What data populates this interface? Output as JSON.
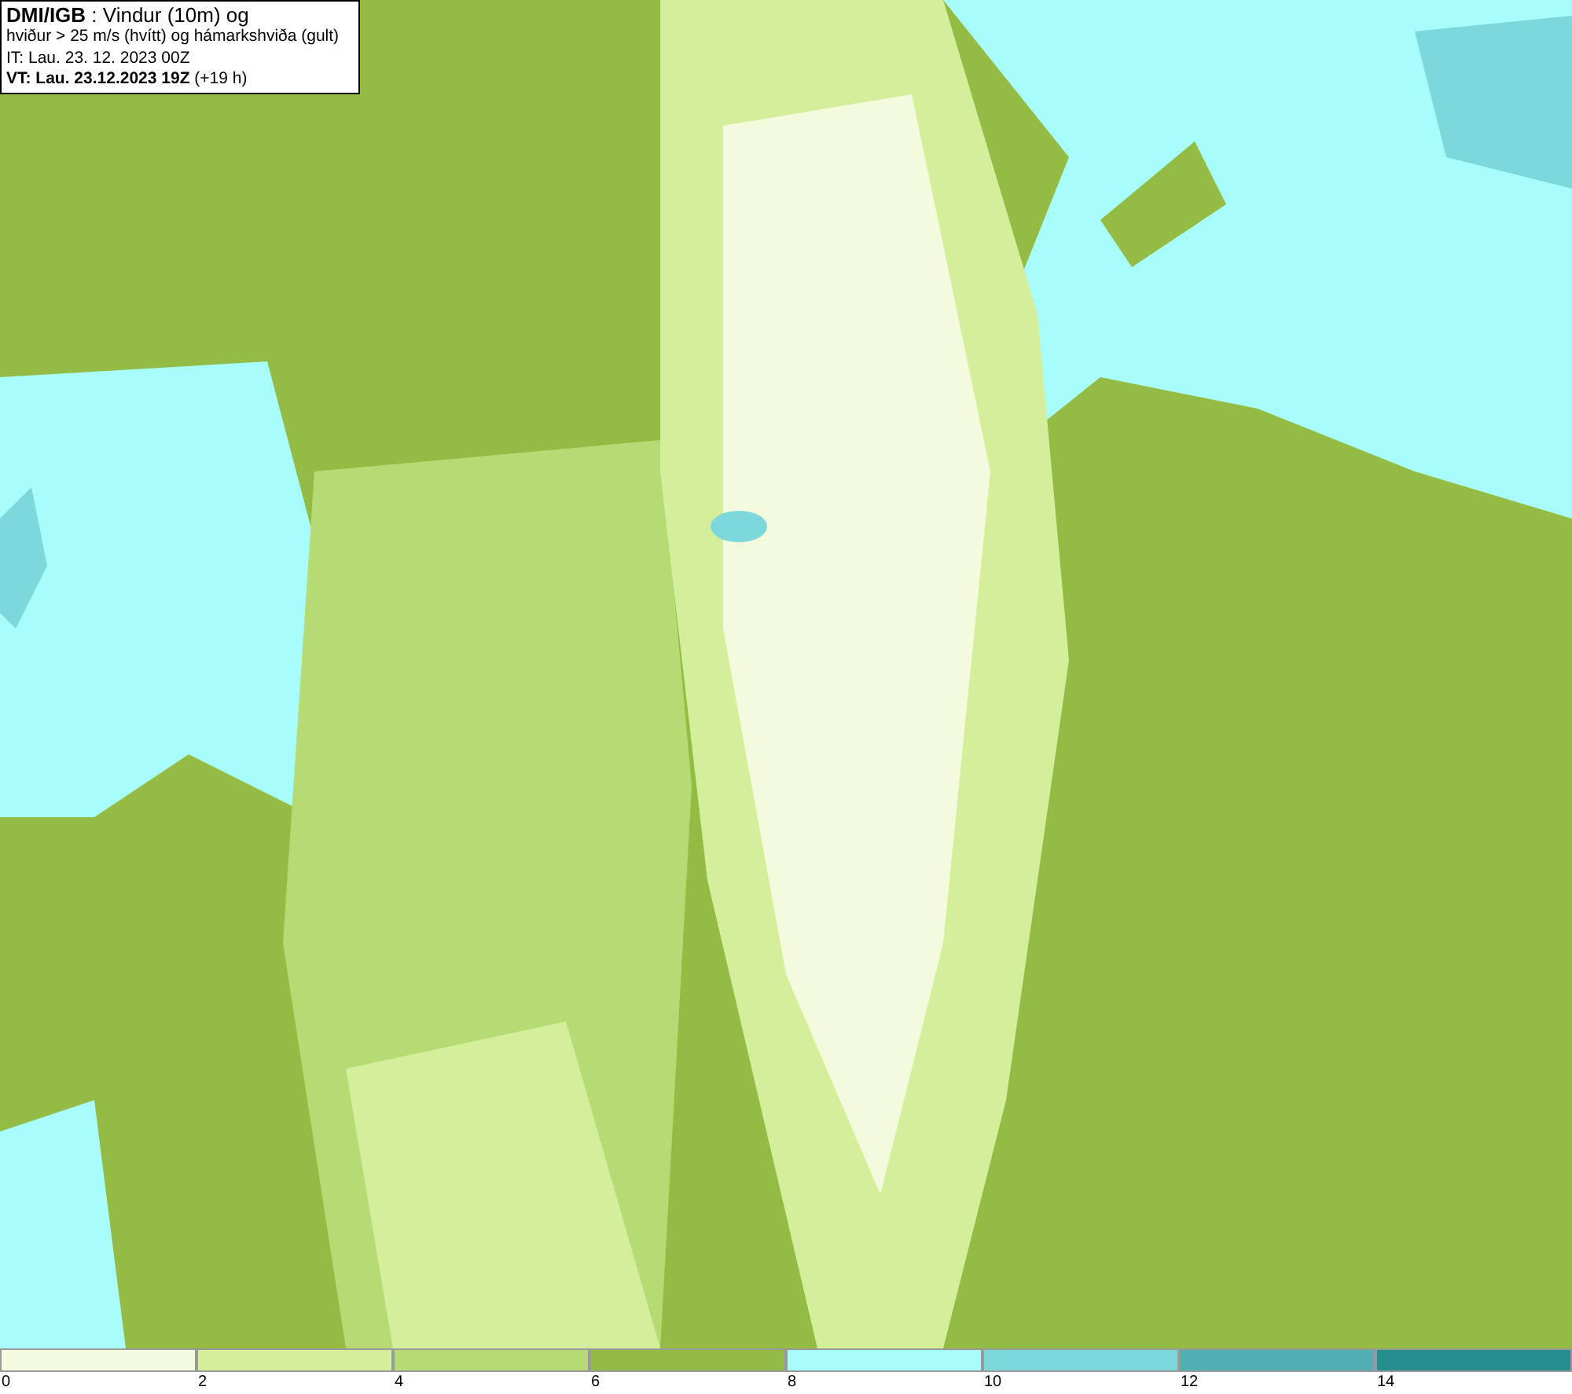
{
  "header": {
    "lines": [
      "**DMI/IGB** : Vindur (10m) og",
      "hviður > 25 m/s (hvítt) og hámarkshviða (gult)",
      "IT: Lau. 23. 12. 2023 00Z",
      "**VT: Lau. 23.12.2023 19Z** (+19 h)"
    ]
  },
  "legend": {
    "swatches": [
      {
        "color": "#f4fbdc"
      },
      {
        "color": "#d5ee9c"
      },
      {
        "color": "#b6db74"
      },
      {
        "color": "#94bc44"
      },
      {
        "color": "#a8fcfa"
      },
      {
        "color": "#7cd8da"
      },
      {
        "color": "#50afb1"
      },
      {
        "color": "#238e8c"
      }
    ],
    "ticks": [
      "0",
      "2",
      "4",
      "6",
      "8",
      "10",
      "12",
      "14"
    ]
  }
}
